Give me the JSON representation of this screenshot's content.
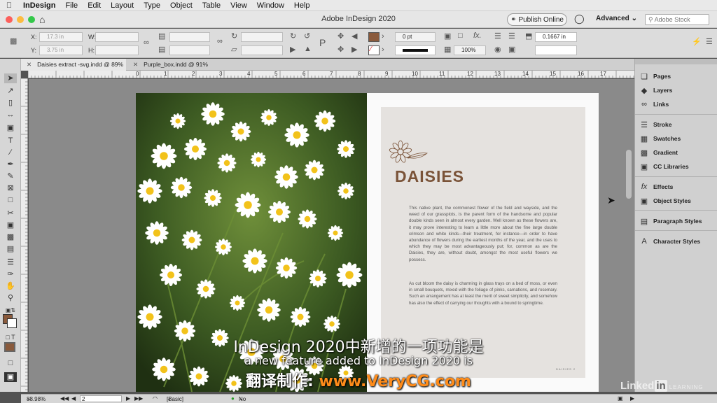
{
  "menubar": {
    "app_name": "InDesign",
    "items": [
      "File",
      "Edit",
      "Layout",
      "Type",
      "Object",
      "Table",
      "View",
      "Window",
      "Help"
    ]
  },
  "titlebar": {
    "title": "Adobe InDesign 2020",
    "publish_label": "Publish Online",
    "workspace_label": "Advanced",
    "stock_placeholder": "Adobe Stock"
  },
  "control_panel": {
    "x_label": "X:",
    "y_label": "Y:",
    "w_label": "W:",
    "h_label": "H:",
    "x_value": "17.3 in",
    "y_value": "3.75 in",
    "stroke_weight": "0 pt",
    "scale_value": "100%",
    "gutter_value": "0.1667 in",
    "fill_color": "#8a5a3c"
  },
  "tabs": [
    {
      "label": "Daisies extract -svg.indd @ 89%",
      "active": true
    },
    {
      "label": "Purple_box.indd @ 91%",
      "active": false
    }
  ],
  "ruler": {
    "marks": [
      "0",
      "1",
      "2",
      "3",
      "4",
      "5",
      "6",
      "7",
      "8",
      "9",
      "10",
      "11",
      "12",
      "13",
      "14",
      "15",
      "16",
      "17"
    ]
  },
  "document": {
    "headline": "DAISIES",
    "paragraph1": "This native plant, the commonest flower of the field and wayside, and the weed of our grassplots, is the parent form of the handsome and popular double kinds seen in almost every garden. Well known as these flowers are, it may prove interesting to learn a little more about the fine large double crimson and white kinds—their treatment, for instance—in order to have abundance of flowers during the earliest months of the year, and the uses to which they may be most advantageously put; for, common as are the Daisies, they are, without doubt, amongst the most useful flowers we possess.",
    "paragraph2": "As cut bloom the daisy is charming in glass trays on a bed of moss, or even in small bouquets, mixed with the foliage of pinks, carnations, and rosemary. Such an arrangement has at least the merit of sweet simplicity, and somehow has also the effect of carrying our thoughts with a bound to springtime.",
    "footer_label": "DAISIES    2",
    "headline_color": "#7a5338"
  },
  "panels": {
    "items": [
      {
        "label": "Pages",
        "icon": "pages-icon"
      },
      {
        "label": "Layers",
        "icon": "layers-icon"
      },
      {
        "label": "Links",
        "icon": "links-icon"
      },
      {
        "label": "Stroke",
        "icon": "stroke-icon"
      },
      {
        "label": "Swatches",
        "icon": "swatches-icon"
      },
      {
        "label": "Gradient",
        "icon": "gradient-icon"
      },
      {
        "label": "CC Libraries",
        "icon": "cc-libraries-icon"
      },
      {
        "label": "Effects",
        "icon": "effects-icon"
      },
      {
        "label": "Object Styles",
        "icon": "object-styles-icon"
      },
      {
        "label": "Paragraph Styles",
        "icon": "paragraph-styles-icon"
      },
      {
        "label": "Character Styles",
        "icon": "character-styles-icon"
      }
    ]
  },
  "statusbar": {
    "zoom": "88.98%",
    "page": "2",
    "style": "[Basic] (working)",
    "preflight": "No errors"
  },
  "subtitles": {
    "line1": "InDesign 2020中新增的一项功能是",
    "line2": "a new feature added to InDesign 2020 is",
    "line3_prefix": "翻译制作: ",
    "line3_site": "www.VeryCG.com"
  },
  "watermark": {
    "brand_a": "Linked",
    "brand_b": "in",
    "brand_c": "LEARNING"
  }
}
